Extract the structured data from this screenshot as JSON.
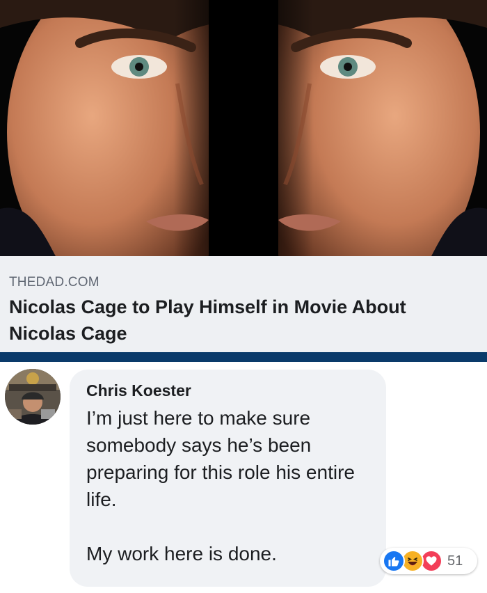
{
  "link_preview": {
    "domain": "THEDAD.COM",
    "headline": "Nicolas Cage to Play Himself in Movie About Nicolas Cage",
    "image_icon": "mirrored-face-photo"
  },
  "comment": {
    "author": "Chris Koester",
    "text": "I’m just here to make sure somebody says he’s been preparing for this role his entire life.\n\nMy work here is done.",
    "avatar_icon": "user-avatar-photo",
    "reactions": {
      "icons": [
        "like-icon",
        "haha-icon",
        "love-icon"
      ],
      "count": "51"
    }
  },
  "colors": {
    "link_bg": "#eef0f3",
    "rule": "#0a3a6a",
    "bubble_bg": "#f0f2f5",
    "like": "#1877f2",
    "haha": "#f7b125",
    "love": "#f33e58"
  }
}
